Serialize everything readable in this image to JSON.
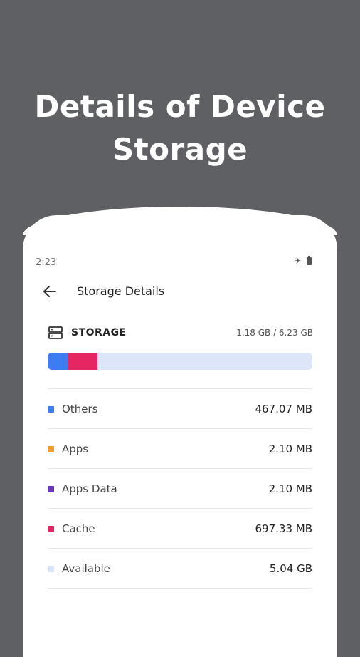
{
  "headline": {
    "line1": "Details of Device",
    "line2": "Storage"
  },
  "status": {
    "time": "2:23",
    "icons": [
      "airplane-mode-icon",
      "battery-icon"
    ]
  },
  "appbar": {
    "title": "Storage Details",
    "back_icon": "arrow-left-icon"
  },
  "storage": {
    "label": "STORAGE",
    "icon": "storage-drive-icon",
    "used_text": "1.18 GB / 6.23 GB",
    "segments": [
      {
        "name": "Others",
        "fraction": 0.075,
        "color": "#3d7df1"
      },
      {
        "name": "Apps",
        "fraction": 0.0003,
        "color": "#f49a2a"
      },
      {
        "name": "Apps Data",
        "fraction": 0.0003,
        "color": "#6a37c0"
      },
      {
        "name": "Cache",
        "fraction": 0.112,
        "color": "#e52663"
      }
    ],
    "track_color": "#dde5f9"
  },
  "items": [
    {
      "label": "Others",
      "value": "467.07 MB",
      "color": "#3d7df1"
    },
    {
      "label": "Apps",
      "value": "2.10 MB",
      "color": "#f49a2a"
    },
    {
      "label": "Apps Data",
      "value": "2.10 MB",
      "color": "#6a37c0"
    },
    {
      "label": "Cache",
      "value": "697.33 MB",
      "color": "#e52663"
    },
    {
      "label": "Available",
      "value": "5.04 GB",
      "color": "#d7e2f7"
    }
  ]
}
